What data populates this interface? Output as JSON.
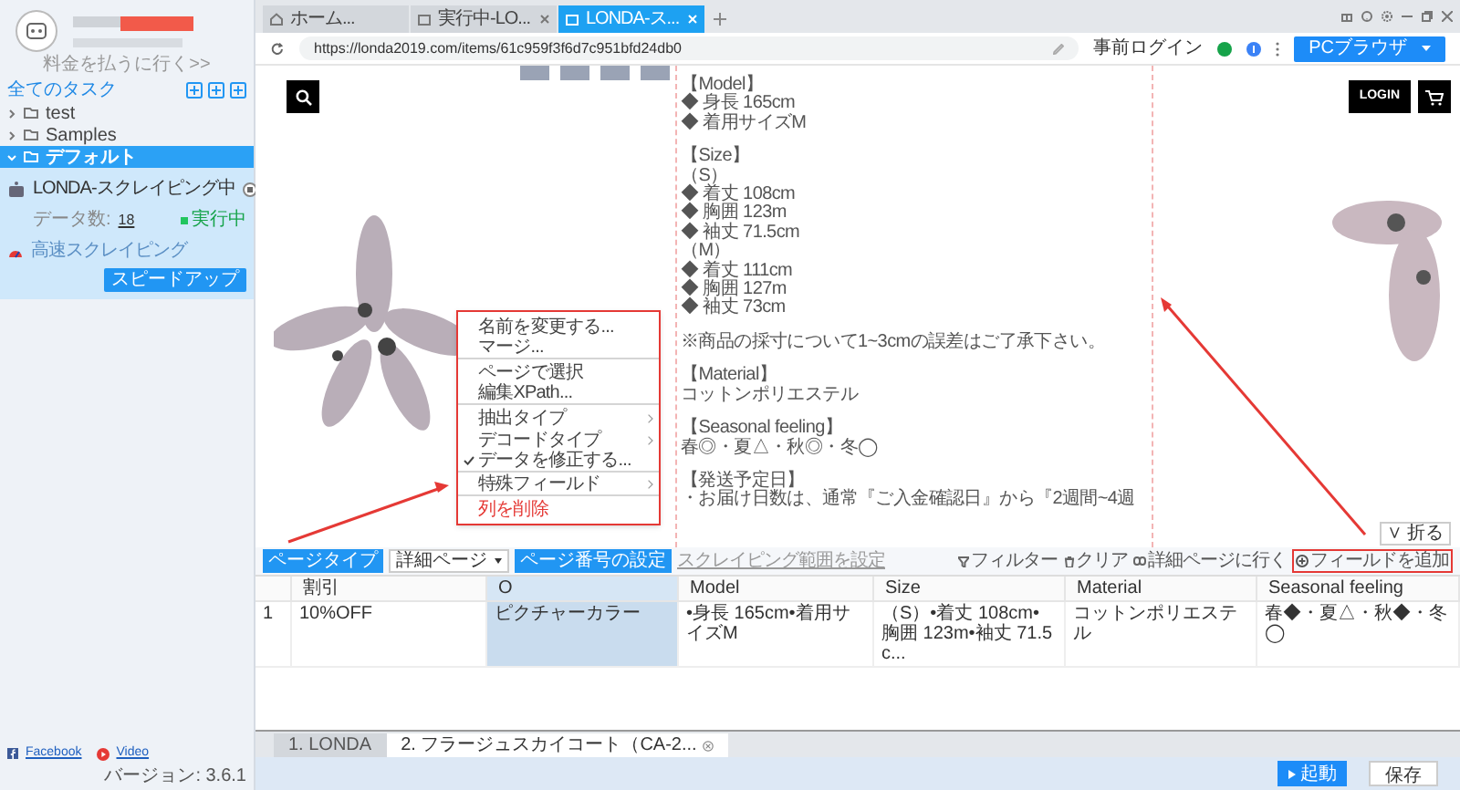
{
  "sidebar": {
    "payment_link": "料金を払うに行く>>",
    "header": "全てのタスク",
    "folders": [
      {
        "name": "test",
        "expanded": false,
        "selected": false
      },
      {
        "name": "Samples",
        "expanded": false,
        "selected": false
      },
      {
        "name": "デフォルト",
        "expanded": true,
        "selected": true
      }
    ],
    "task": {
      "name": "LONDA-スクレイピング中",
      "data_label": "データ数:",
      "count": "18",
      "status": "実行中",
      "mode": "高速スクレイピング",
      "button": "スピードアップ"
    },
    "footer": {
      "facebook": "Facebook",
      "video": "Video",
      "version": "バージョン: 3.6.1"
    }
  },
  "browser_tabs": [
    {
      "label": "ホーム...",
      "kind": "home",
      "selected": false
    },
    {
      "label": "実行中-LO...",
      "kind": "page",
      "selected": false
    },
    {
      "label": "LONDA-ス...",
      "kind": "page",
      "selected": true
    }
  ],
  "address_bar": {
    "url": "https://londa2019.com/items/61c959f3f6d7c951bfd24db0",
    "login": "事前ログイン",
    "browser_button": "PCブラウザ"
  },
  "webpage": {
    "login_button": "LOGIN",
    "fold_button": "∨ 折る",
    "blocks": [
      [
        "【Model】",
        "◆ 身長 165cm",
        "◆ 着用サイズM"
      ],
      [
        "【Size】",
        "（S）",
        "◆ 着丈 108cm",
        "◆ 胸囲 123m",
        "◆ 袖丈 71.5cm",
        "（M）",
        "◆ 着丈 111cm",
        "◆ 胸囲 127m",
        "◆ 袖丈 73cm"
      ],
      [
        "※商品の採寸について1~3cmの誤差はご了承下さい。"
      ],
      [
        "【Material】",
        "コットンポリエステル"
      ],
      [
        "【Seasonal feeling】",
        "春◎・夏△・秋◎・冬◯"
      ],
      [
        "【発送予定日】",
        "・お届け日数は、通常『ご入金確認日』から『2週間~4週"
      ]
    ]
  },
  "context_menu": [
    {
      "label": "名前を変更する...",
      "kind": "item",
      "checked": false,
      "divider_after": false
    },
    {
      "label": "マージ...",
      "kind": "item",
      "checked": false,
      "divider_after": true
    },
    {
      "label": "ページで選択",
      "kind": "item",
      "checked": false,
      "divider_after": false
    },
    {
      "label": "編集XPath...",
      "kind": "item",
      "checked": false,
      "divider_after": true
    },
    {
      "label": "抽出タイプ",
      "kind": "submenu",
      "checked": false,
      "divider_after": false
    },
    {
      "label": "デコードタイプ",
      "kind": "submenu",
      "checked": false,
      "divider_after": false
    },
    {
      "label": "データを修正する...",
      "kind": "item",
      "checked": true,
      "divider_after": true
    },
    {
      "label": "特殊フィールド",
      "kind": "submenu",
      "checked": false,
      "divider_after": true
    },
    {
      "label": "列を削除",
      "kind": "danger",
      "checked": false,
      "divider_after": false
    }
  ],
  "toolbar": {
    "page_type_label": "ページタイプ",
    "page_type": "詳細ページ",
    "page_number": "ページ番号の設定",
    "range_link": "スクレイピング範囲を設定",
    "filter": "フィルター",
    "clear": "クリア",
    "go_detail": "詳細ページに行く",
    "add_field": "フィールドを追加"
  },
  "table": {
    "columns": [
      {
        "label": "割引",
        "selected": false
      },
      {
        "label": "O",
        "selected": true
      },
      {
        "label": "Model",
        "selected": false
      },
      {
        "label": "Size",
        "selected": false
      },
      {
        "label": "Material",
        "selected": false
      },
      {
        "label": "Seasonal feeling",
        "selected": false
      }
    ],
    "rows": [
      {
        "number": "1",
        "cells": [
          "10%OFF",
          "ピクチャーカラー",
          "•身長 165cm•着用サイズM",
          "（S）•着丈 108cm•胸囲 123m•袖丈 71.5c...",
          "コットンポリエステル",
          "春◆・夏△・秋◆・冬◯"
        ]
      }
    ]
  },
  "task_tabs": [
    {
      "label": "1. LONDA",
      "selected": false,
      "closable": false
    },
    {
      "label": "2. フラージュスカイコート（CA-2...",
      "selected": true,
      "closable": true
    }
  ],
  "actions": {
    "start": "起動",
    "save": "保存"
  }
}
